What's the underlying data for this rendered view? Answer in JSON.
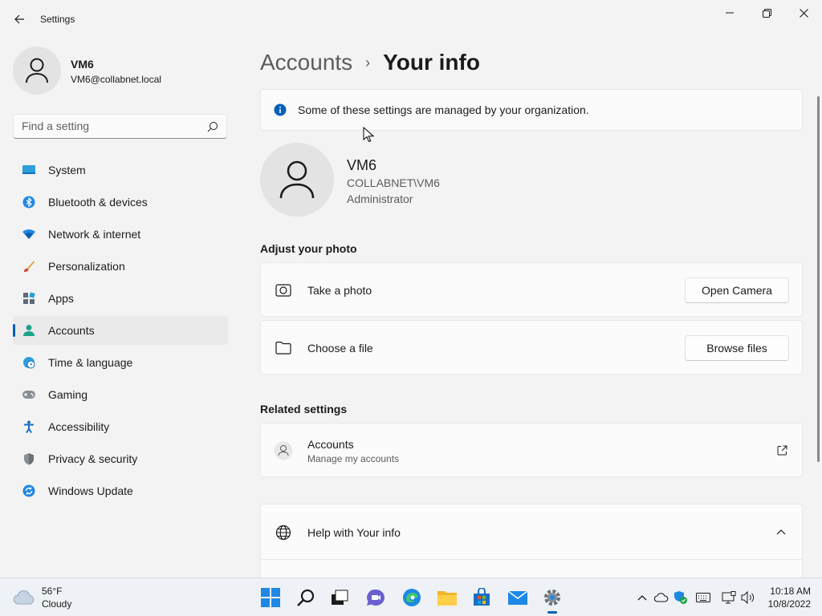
{
  "window": {
    "title": "Settings"
  },
  "profile": {
    "name": "VM6",
    "email": "VM6@collabnet.local"
  },
  "search": {
    "placeholder": "Find a setting"
  },
  "sidebar": {
    "items": [
      {
        "label": "System",
        "icon": "system-icon"
      },
      {
        "label": "Bluetooth & devices",
        "icon": "bluetooth-icon"
      },
      {
        "label": "Network & internet",
        "icon": "wifi-icon"
      },
      {
        "label": "Personalization",
        "icon": "brush-icon"
      },
      {
        "label": "Apps",
        "icon": "apps-icon"
      },
      {
        "label": "Accounts",
        "icon": "person-icon",
        "active": true
      },
      {
        "label": "Time & language",
        "icon": "globe-clock-icon"
      },
      {
        "label": "Gaming",
        "icon": "gamepad-icon"
      },
      {
        "label": "Accessibility",
        "icon": "accessibility-icon"
      },
      {
        "label": "Privacy & security",
        "icon": "shield-icon"
      },
      {
        "label": "Windows Update",
        "icon": "update-icon"
      }
    ]
  },
  "breadcrumb": {
    "parent": "Accounts",
    "separator": "›",
    "current": "Your info"
  },
  "info_bar": {
    "text": "Some of these settings are managed by your organization."
  },
  "user": {
    "name": "VM6",
    "domain": "COLLABNET\\VM6",
    "role": "Administrator"
  },
  "adjust_photo": {
    "title": "Adjust your photo",
    "take_photo": {
      "label": "Take a photo",
      "button": "Open Camera"
    },
    "choose_file": {
      "label": "Choose a file",
      "button": "Browse files"
    }
  },
  "related": {
    "title": "Related settings",
    "accounts": {
      "label": "Accounts",
      "sub": "Manage my accounts"
    }
  },
  "help": {
    "label": "Help with Your info"
  },
  "taskbar": {
    "weather_temp": "56°F",
    "weather_desc": "Cloudy",
    "time": "10:18 AM",
    "date": "10/8/2022"
  },
  "colors": {
    "accent": "#005fb8",
    "background": "#f3f3f3",
    "card": "#fbfbfb"
  }
}
